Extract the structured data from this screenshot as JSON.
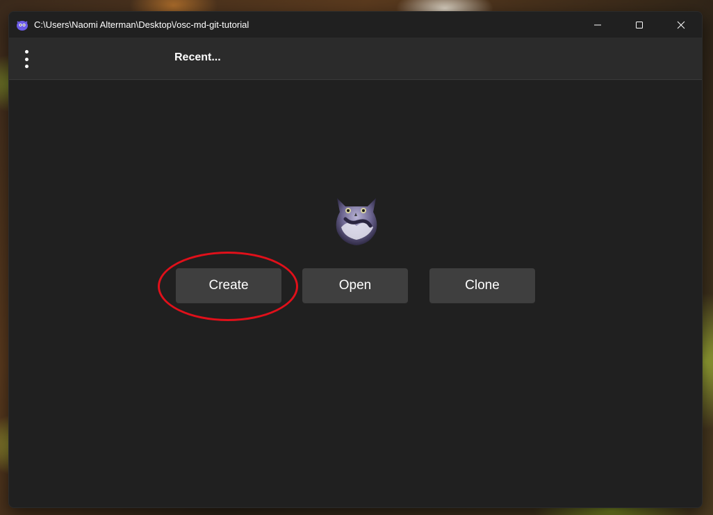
{
  "window": {
    "title": "C:\\Users\\Naomi Alterman\\Desktop\\/osc-md-git-tutorial",
    "app_icon": "owl-app-icon",
    "controls": [
      "minimize-icon",
      "maximize-icon",
      "close-icon"
    ]
  },
  "toolbar": {
    "menu_icon": "kebab-menu-icon",
    "recent_label": "Recent..."
  },
  "main": {
    "logo": "owl-logo",
    "buttons": {
      "create": "Create",
      "open": "Open",
      "clone": "Clone"
    }
  },
  "colors": {
    "window_bg": "#202020",
    "toolbar_bg": "#2b2b2b",
    "button_bg": "#3f3f3f",
    "annotation_red": "#e0101a"
  }
}
